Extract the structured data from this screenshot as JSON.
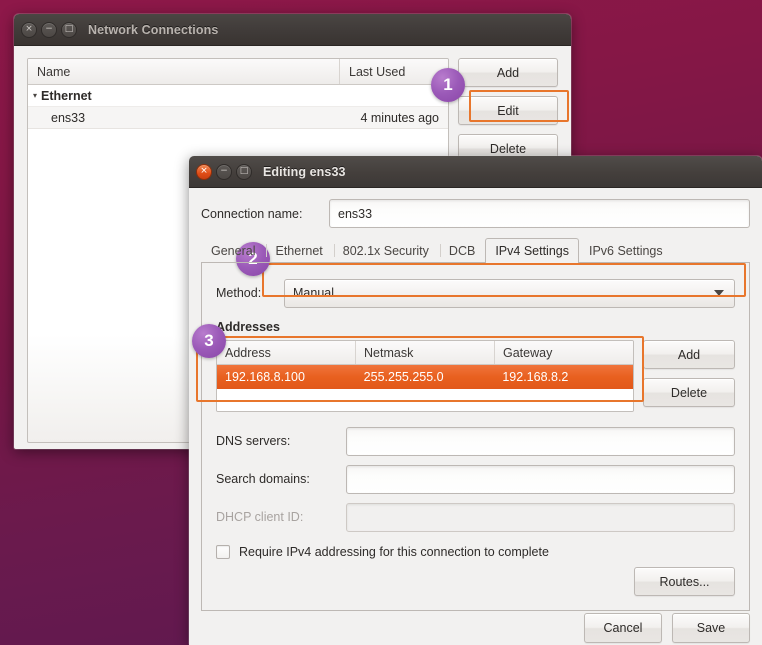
{
  "desktop": {
    "bg_top": "#8e1849",
    "bg_bottom": "#5c1850"
  },
  "accent": {
    "highlight": "#e8762c",
    "selection": "#e8601f",
    "badge": "#9b5ab8"
  },
  "network_connections_window": {
    "title": "Network Connections",
    "window_buttons": {
      "close": "×",
      "minimize": "−",
      "maximize": "□"
    },
    "list": {
      "columns": [
        "Name",
        "Last Used"
      ],
      "groups": [
        {
          "label": "Ethernet",
          "expanded_marker": "▾",
          "rows": [
            {
              "name": "ens33",
              "last_used": "4 minutes ago"
            }
          ]
        }
      ]
    },
    "buttons": {
      "add": "Add",
      "edit": "Edit",
      "delete": "Delete"
    }
  },
  "edit_dialog": {
    "title": "Editing ens33",
    "window_buttons": {
      "close": "×",
      "minimize": "−",
      "maximize": "□"
    },
    "connection_name": {
      "label": "Connection name:",
      "value": "ens33"
    },
    "tabs": [
      {
        "label": "General",
        "active": false
      },
      {
        "label": "Ethernet",
        "active": false
      },
      {
        "label": "802.1x Security",
        "active": false
      },
      {
        "label": "DCB",
        "active": false
      },
      {
        "label": "IPv4 Settings",
        "active": true
      },
      {
        "label": "IPv6 Settings",
        "active": false
      }
    ],
    "method": {
      "label": "Method:",
      "value": "Manual"
    },
    "addresses": {
      "section_title": "Addresses",
      "columns": [
        "Address",
        "Netmask",
        "Gateway"
      ],
      "rows": [
        {
          "address": "192.168.8.100",
          "netmask": "255.255.255.0",
          "gateway": "192.168.8.2",
          "selected": true
        }
      ],
      "add_label": "Add",
      "delete_label": "Delete"
    },
    "fields": [
      {
        "label": "DNS servers:",
        "value": "",
        "disabled": false
      },
      {
        "label": "Search domains:",
        "value": "",
        "disabled": false
      },
      {
        "label": "DHCP client ID:",
        "value": "",
        "disabled": true
      }
    ],
    "require_ipv4": {
      "label": "Require IPv4 addressing for this connection to complete",
      "checked": false
    },
    "routes_label": "Routes...",
    "cancel_label": "Cancel",
    "save_label": "Save"
  },
  "annotations": {
    "badges": [
      {
        "number": "1"
      },
      {
        "number": "2"
      },
      {
        "number": "3"
      }
    ]
  }
}
